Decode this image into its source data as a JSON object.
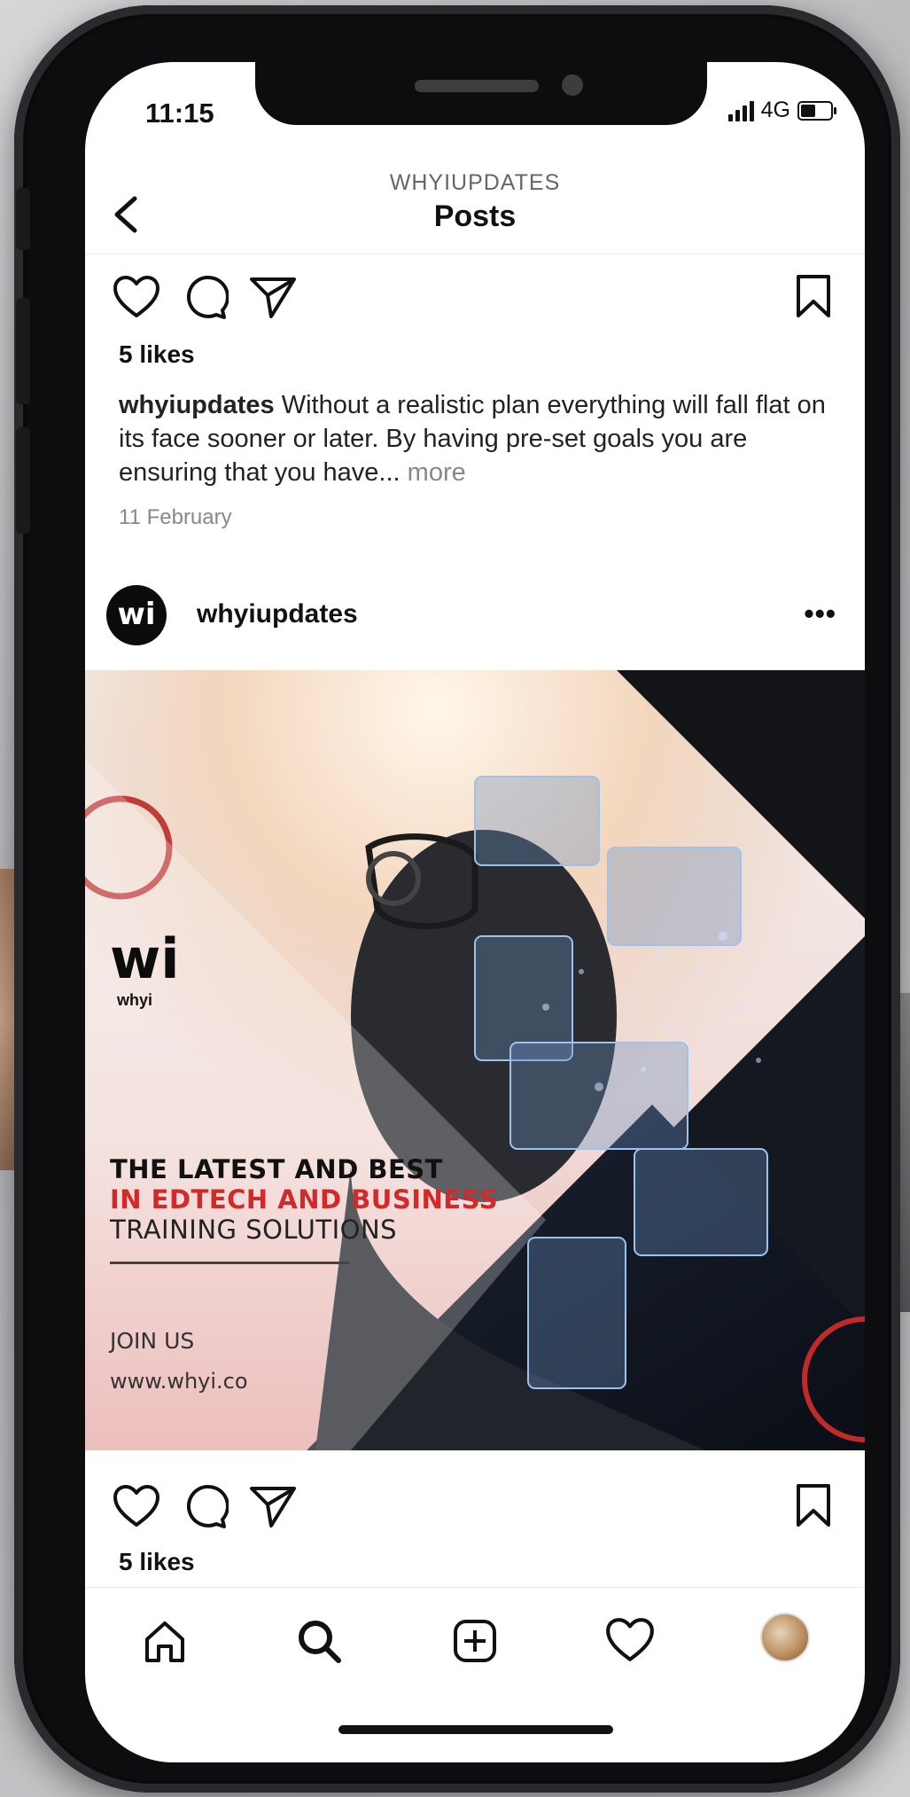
{
  "status_bar": {
    "time": "11:15",
    "network": "4G"
  },
  "header": {
    "subtitle": "WHYIUPDATES",
    "title": "Posts"
  },
  "post1": {
    "likes": "5 likes",
    "caption_user": "whyiupdates",
    "caption_text": " Without a realistic plan everything will fall flat on its face sooner or later. By having pre-set goals you are ensuring that you have...",
    "more": " more",
    "date": "11 February"
  },
  "post2": {
    "avatar_text": "wi",
    "username": "whyiupdates",
    "menu": "•••",
    "image": {
      "brand_mark": "wi",
      "brand_name": "whyi",
      "line1": "THE LATEST AND BEST",
      "line2": "IN EDTECH AND BUSINESS",
      "line3": "TRAINING SOLUTIONS",
      "cta": "JOIN US",
      "url": "www.whyi.co"
    },
    "likes": "5 likes"
  },
  "icons": {
    "back": "chevron-left-icon",
    "like": "heart-icon",
    "comment": "comment-icon",
    "share": "send-icon",
    "save": "bookmark-icon",
    "nav": [
      "home-icon",
      "search-icon",
      "add-post-icon",
      "activity-heart-icon",
      "profile-avatar"
    ]
  },
  "colors": {
    "accent_red": "#d22a2a",
    "text": "#111111",
    "muted": "#888888"
  }
}
